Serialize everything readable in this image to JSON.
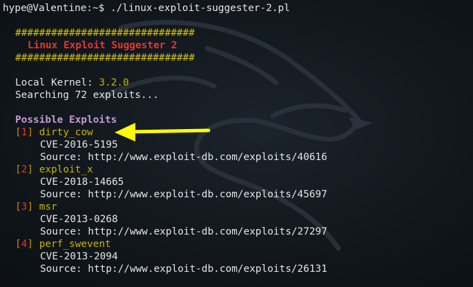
{
  "terminal": {
    "prompt": "hype@Valentine:~$ ",
    "command": "./linux-exploit-suggester-2.pl"
  },
  "banner": {
    "hash_line": "##############################",
    "title": "Linux Exploit Suggester 2"
  },
  "kernel": {
    "label": "Local Kernel: ",
    "version": "3.2.0"
  },
  "search_status": "Searching 72 exploits...",
  "possible_heading": "Possible Exploits",
  "exploits": [
    {
      "index": "1",
      "name": "dirty_cow",
      "cve": "CVE-2016-5195",
      "source": "Source: http://www.exploit-db.com/exploits/40616"
    },
    {
      "index": "2",
      "name": "exploit_x",
      "cve": "CVE-2018-14665",
      "source": "Source: http://www.exploit-db.com/exploits/45697"
    },
    {
      "index": "3",
      "name": "msr",
      "cve": "CVE-2013-0268",
      "source": "Source: http://www.exploit-db.com/exploits/27297"
    },
    {
      "index": "4",
      "name": "perf_swevent",
      "cve": "CVE-2013-2094",
      "source": "Source: http://www.exploit-db.com/exploits/26131"
    }
  ],
  "colors": {
    "background": "#0d1318",
    "hash": "#d4c000",
    "banner": "#e8352d",
    "heading": "#c79ad1",
    "exploit_name": "#c9b300",
    "arrow": "#ffff00"
  },
  "icons": {
    "watermark": "kali-dragon-icon",
    "annotation": "arrow-left-icon"
  }
}
